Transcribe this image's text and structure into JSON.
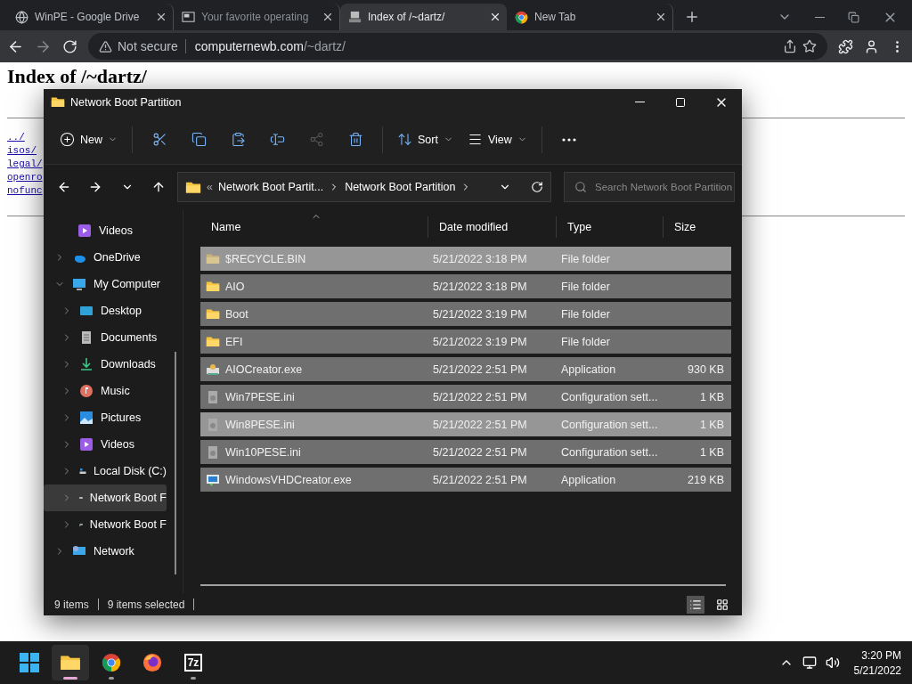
{
  "browser": {
    "tabs": [
      {
        "title": "WinPE - Google Drive",
        "kind": "globe",
        "selected": false,
        "faded": false
      },
      {
        "title": "Your favorite operating",
        "kind": "screen",
        "selected": false,
        "faded": true
      },
      {
        "title": "Index of /~dartz/",
        "kind": "computer",
        "selected": true,
        "faded": false
      },
      {
        "title": "New Tab",
        "kind": "chrome",
        "selected": false,
        "faded": false
      }
    ],
    "security": "Not secure",
    "url_host": "computernewb.com",
    "url_path": "/~dartz/"
  },
  "page": {
    "heading": "Index of /~dartz/",
    "links": [
      "../",
      "isos/",
      "legal/",
      "openro",
      "nofunc"
    ]
  },
  "explorer": {
    "title": "Network Boot Partition",
    "commands": [
      {
        "kind": "new",
        "label": "New",
        "disabled": false
      },
      {
        "kind": "cut",
        "disabled": false
      },
      {
        "kind": "copy",
        "disabled": false
      },
      {
        "kind": "paste",
        "disabled": false
      },
      {
        "kind": "rename",
        "disabled": false
      },
      {
        "kind": "share",
        "disabled": true
      },
      {
        "kind": "delete",
        "disabled": false
      },
      {
        "kind": "sort",
        "label": "Sort",
        "disabled": false
      },
      {
        "kind": "view",
        "label": "View",
        "disabled": false
      },
      {
        "kind": "more",
        "disabled": false
      }
    ],
    "breadcrumb": {
      "overflow": "«",
      "crumbs": [
        "Network Boot Partit...",
        "Network Boot Partition"
      ]
    },
    "search": {
      "placeholder": "Search Network Boot Partition"
    },
    "nav_items": [
      {
        "label": "Videos",
        "kind": "videos",
        "nested": true,
        "expandable": false,
        "expanded": false,
        "selected": false
      },
      {
        "label": "OneDrive",
        "kind": "cloud",
        "nested": false,
        "expandable": true,
        "expanded": false,
        "selected": false
      },
      {
        "label": "My Computer",
        "kind": "pc",
        "nested": false,
        "expandable": true,
        "expanded": true,
        "selected": false,
        "children": [
          {
            "label": "Desktop",
            "kind": "desktop",
            "expandable": true,
            "expanded": false,
            "selected": false
          },
          {
            "label": "Documents",
            "kind": "documents",
            "expandable": true,
            "expanded": false,
            "selected": false
          },
          {
            "label": "Downloads",
            "kind": "downloads",
            "expandable": true,
            "expanded": false,
            "selected": false
          },
          {
            "label": "Music",
            "kind": "music",
            "expandable": true,
            "expanded": false,
            "selected": false
          },
          {
            "label": "Pictures",
            "kind": "pictures",
            "expandable": true,
            "expanded": false,
            "selected": false
          },
          {
            "label": "Videos",
            "kind": "videos",
            "expandable": true,
            "expanded": false,
            "selected": false
          },
          {
            "label": "Local Disk (C:)",
            "kind": "disk",
            "expandable": true,
            "expanded": false,
            "selected": false
          },
          {
            "label": "Network Boot F",
            "kind": "drive",
            "expandable": true,
            "expanded": false,
            "selected": true
          },
          {
            "label": "Network Boot F",
            "kind": "netdrive",
            "expandable": true,
            "expanded": false,
            "selected": false
          }
        ]
      },
      {
        "label": "Network",
        "kind": "network",
        "nested": false,
        "expandable": true,
        "expanded": false,
        "selected": false
      }
    ],
    "columns": [
      "Name",
      "Date modified",
      "Type",
      "Size"
    ],
    "files": [
      {
        "name": "$RECYCLE.BIN",
        "date": "5/21/2022 3:18 PM",
        "type": "File folder",
        "kind": "folder-faded",
        "selected": true,
        "hovered": true
      },
      {
        "name": "AIO",
        "date": "5/21/2022 3:18 PM",
        "type": "File folder",
        "kind": "folder",
        "selected": true,
        "hovered": false
      },
      {
        "name": "Boot",
        "date": "5/21/2022 3:19 PM",
        "type": "File folder",
        "kind": "folder",
        "selected": true,
        "hovered": false
      },
      {
        "name": "EFI",
        "date": "5/21/2022 3:19 PM",
        "type": "File folder",
        "kind": "folder",
        "selected": true,
        "hovered": false
      },
      {
        "name": "AIOCreator.exe",
        "date": "5/21/2022 2:51 PM",
        "type": "Application",
        "size": "930 KB",
        "kind": "app",
        "selected": true,
        "hovered": false
      },
      {
        "name": "Win7PESE.ini",
        "date": "5/21/2022 2:51 PM",
        "type": "Configuration sett...",
        "size": "1 KB",
        "kind": "config",
        "selected": true,
        "hovered": false
      },
      {
        "name": "Win8PESE.ini",
        "date": "5/21/2022 2:51 PM",
        "type": "Configuration sett...",
        "size": "1 KB",
        "kind": "config",
        "selected": true,
        "hovered": true
      },
      {
        "name": "Win10PESE.ini",
        "date": "5/21/2022 2:51 PM",
        "type": "Configuration sett...",
        "size": "1 KB",
        "kind": "config",
        "selected": true,
        "hovered": false
      },
      {
        "name": "WindowsVHDCreator.exe",
        "date": "5/21/2022 2:51 PM",
        "type": "Application",
        "size": "219 KB",
        "kind": "vhd",
        "selected": true,
        "hovered": false
      }
    ],
    "status": {
      "count": "9 items",
      "selection": "9 items selected"
    },
    "views": [
      {
        "kind": "details",
        "selected": true
      },
      {
        "kind": "tiles",
        "selected": false
      }
    ]
  },
  "taskbar": {
    "apps": [
      {
        "kind": "start",
        "active": false,
        "running": false
      },
      {
        "kind": "explorer",
        "active": true,
        "running": true
      },
      {
        "kind": "chrome",
        "active": false,
        "running": true
      },
      {
        "kind": "firefox",
        "active": false,
        "running": false
      },
      {
        "kind": "sevenzip",
        "label": "7z",
        "active": false,
        "running": true
      }
    ],
    "time": "3:20 PM",
    "date": "5/21/2022"
  }
}
